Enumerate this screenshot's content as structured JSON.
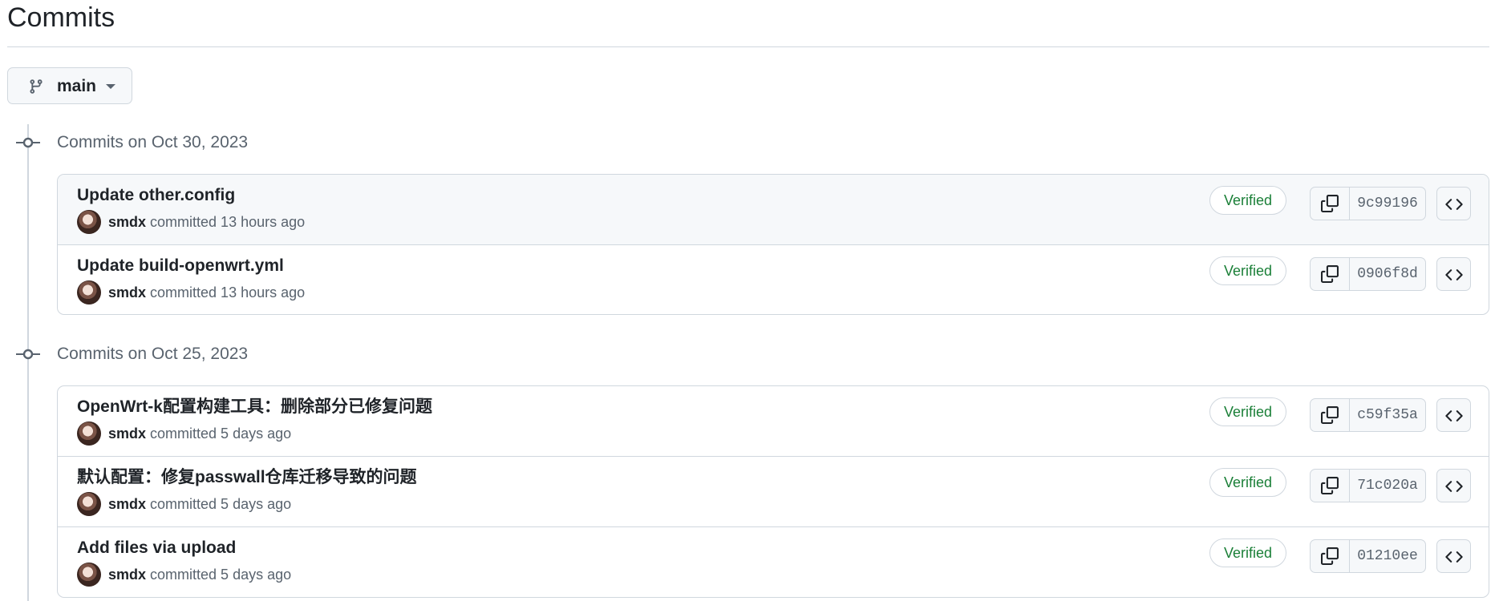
{
  "page": {
    "title": "Commits"
  },
  "branch": {
    "name": "main",
    "icon": "git-branch-icon"
  },
  "groups": [
    {
      "label": "Commits on Oct 30, 2023",
      "commits": [
        {
          "title": "Update other.config",
          "author": "smdx",
          "time": "committed 13 hours ago",
          "badge": "Verified",
          "sha": "9c99196",
          "highlighted": true
        },
        {
          "title": "Update build-openwrt.yml",
          "author": "smdx",
          "time": "committed 13 hours ago",
          "badge": "Verified",
          "sha": "0906f8d"
        }
      ]
    },
    {
      "label": "Commits on Oct 25, 2023",
      "commits": [
        {
          "title": "OpenWrt-k配置构建工具：删除部分已修复问题",
          "author": "smdx",
          "time": "committed 5 days ago",
          "badge": "Verified",
          "sha": "c59f35a"
        },
        {
          "title": "默认配置：修复passwall仓库迁移导致的问题",
          "author": "smdx",
          "time": "committed 5 days ago",
          "badge": "Verified",
          "sha": "71c020a"
        },
        {
          "title": "Add files via upload",
          "author": "smdx",
          "time": "committed 5 days ago",
          "badge": "Verified",
          "sha": "01210ee"
        }
      ]
    }
  ],
  "colors": {
    "verified": "#1a7f37",
    "border": "#d0d7de",
    "muted": "#59636e",
    "highlight_row": "#f6f8fa"
  }
}
